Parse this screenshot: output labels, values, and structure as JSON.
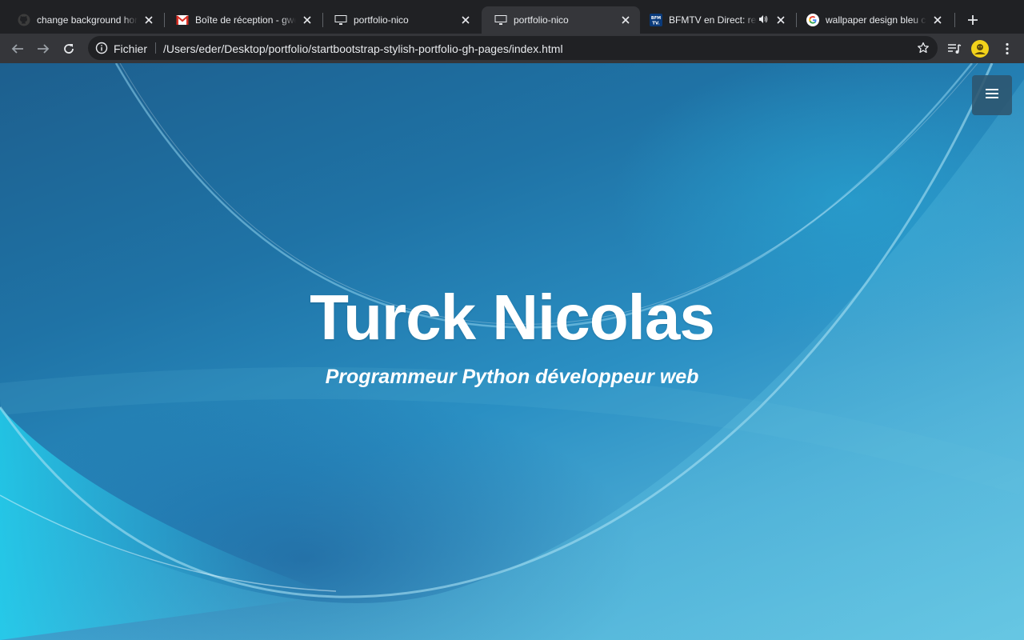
{
  "tabs": [
    {
      "title": "change background hom",
      "favicon": "github-icon",
      "active": false,
      "audio": false
    },
    {
      "title": "Boîte de réception - gwe",
      "favicon": "gmail-icon",
      "active": false,
      "audio": false
    },
    {
      "title": "portfolio-nico",
      "favicon": "monitor-icon",
      "active": false,
      "audio": false
    },
    {
      "title": "portfolio-nico",
      "favicon": "monitor-icon",
      "active": true,
      "audio": false
    },
    {
      "title": "BFMTV en Direct: re",
      "favicon": "bfmtv-icon",
      "active": false,
      "audio": true
    },
    {
      "title": "wallpaper design bleu c",
      "favicon": "google-icon",
      "active": false,
      "audio": false
    }
  ],
  "toolbar": {
    "scheme_label": "Fichier",
    "url": "/Users/eder/Desktop/portfolio/startbootstrap-stylish-portfolio-gh-pages/index.html"
  },
  "page": {
    "title": "Turck Nicolas",
    "subtitle": "Programmeur Python développeur web",
    "menu_icon": "hamburger-icon"
  },
  "colors": {
    "tab_strip": "#202124",
    "toolbar": "#35363a",
    "hero_text": "#ffffff",
    "menu_button": "#2d556e"
  }
}
